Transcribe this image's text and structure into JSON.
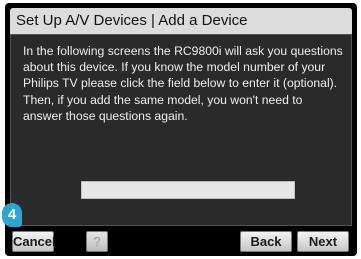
{
  "window": {
    "title": "Set Up A/V Devices | Add a Device"
  },
  "content": {
    "instructions": "In the following screens the RC9800i will ask you questions about this device. If you know the model number of your Philips TV please click the field below to enter it (optional). Then, if you add the same model, you won't need to answer those questions again.",
    "model_field": {
      "value": "",
      "placeholder": ""
    }
  },
  "step_badge": {
    "number": "4",
    "color": "#2aa5d4"
  },
  "buttons": {
    "cancel_label": "Cancel",
    "help_label": "?",
    "back_label": "Back",
    "next_label": "Next"
  }
}
